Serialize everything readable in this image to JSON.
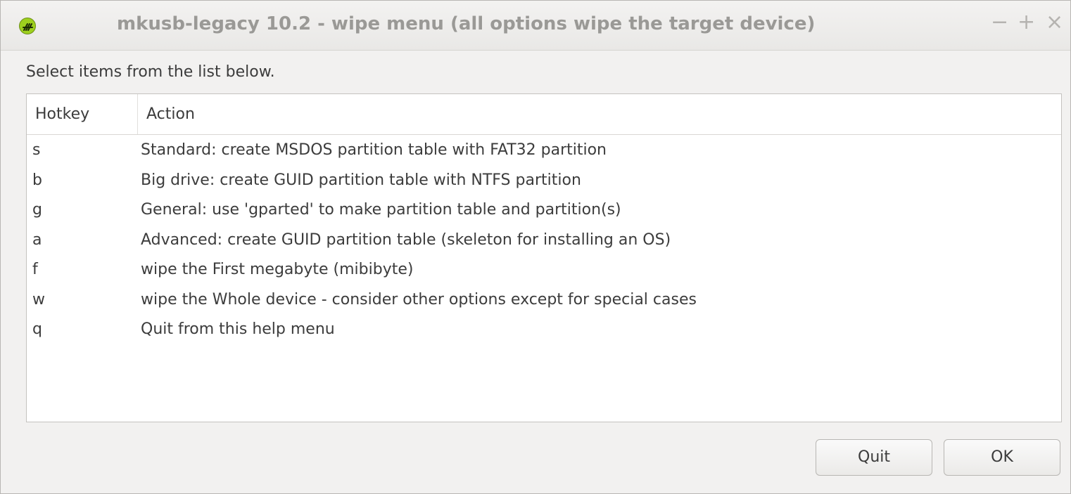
{
  "window": {
    "title": "mkusb-legacy 10.2 - wipe menu (all options wipe the target device)",
    "controls": {
      "minimize": "−",
      "maximize": "+",
      "close": "×"
    }
  },
  "prompt": "Select items from the list below.",
  "list": {
    "columns": {
      "hotkey": "Hotkey",
      "action": "Action"
    },
    "rows": [
      {
        "hotkey": "s",
        "action": "Standard: create MSDOS partition table with FAT32 partition"
      },
      {
        "hotkey": "b",
        "action": "Big drive: create GUID partition table with NTFS partition"
      },
      {
        "hotkey": "g",
        "action": "General: use 'gparted' to make partition table and partition(s)"
      },
      {
        "hotkey": "a",
        "action": "Advanced: create GUID partition table (skeleton for installing an OS)"
      },
      {
        "hotkey": "f",
        "action": "wipe the First megabyte (mibibyte)"
      },
      {
        "hotkey": "w",
        "action": "wipe the Whole device - consider other options except for special cases"
      },
      {
        "hotkey": "q",
        "action": "Quit from this help menu"
      }
    ]
  },
  "buttons": {
    "quit": "Quit",
    "ok": "OK"
  },
  "icons": {
    "app": "mkusb-app-icon"
  },
  "colors": {
    "app_icon": "#9ed01e",
    "title_text": "#9a9996"
  }
}
